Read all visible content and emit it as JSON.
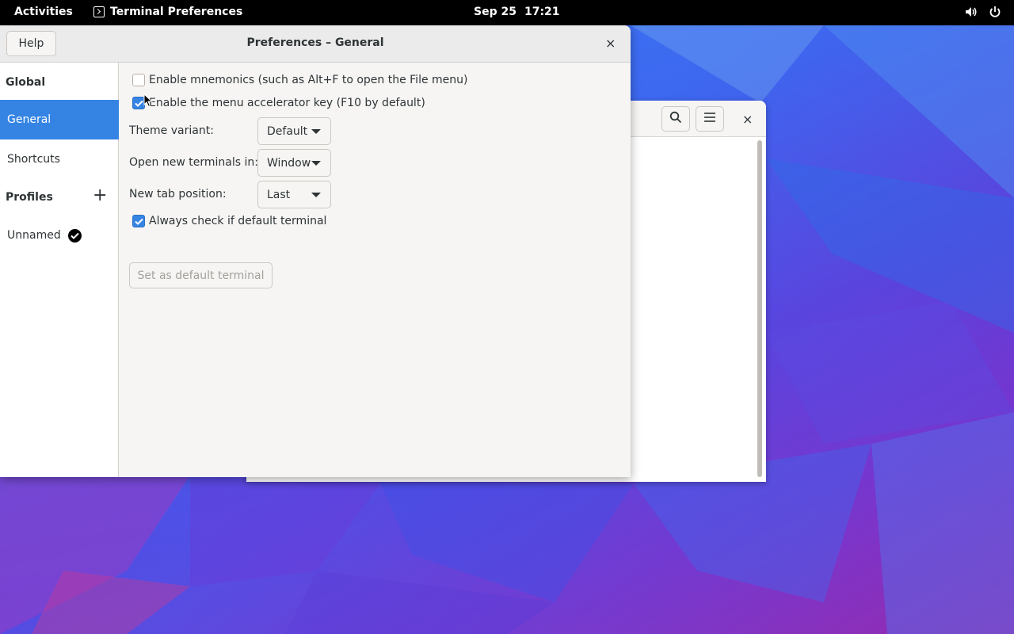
{
  "topbar": {
    "activities": "Activities",
    "app_name": "Terminal Preferences",
    "date": "Sep 25",
    "time": "17:21",
    "icons": [
      "volume-icon",
      "power-icon"
    ]
  },
  "prefs_window": {
    "help_label": "Help",
    "title": "Preferences – General",
    "close_glyph": "×"
  },
  "sidebar": {
    "global_heading": "Global",
    "items": [
      {
        "label": "General",
        "selected": true
      },
      {
        "label": "Shortcuts",
        "selected": false
      }
    ],
    "profiles_heading": "Profiles",
    "add_glyph": "+",
    "profiles": [
      {
        "label": "Unnamed",
        "default": true
      }
    ]
  },
  "general": {
    "enable_mnemonics": {
      "label": "Enable mnemonics (such as Alt+F to open the File menu)",
      "checked": false
    },
    "enable_accel": {
      "label": "Enable the menu accelerator key (F10 by default)",
      "checked": true
    },
    "theme_variant": {
      "label": "Theme variant:",
      "value": "Default"
    },
    "open_new_terminals": {
      "label": "Open new terminals in:",
      "value": "Window"
    },
    "new_tab_position": {
      "label": "New tab position:",
      "value": "Last"
    },
    "always_check": {
      "label": "Always check if default terminal",
      "checked": true
    },
    "set_default_label": "Set as default terminal"
  },
  "bg_window": {
    "close_glyph": "×",
    "icons": [
      "search-icon",
      "hamburger-menu-icon"
    ]
  },
  "colors": {
    "accent": "#3584e4",
    "window_bg": "#f6f5f4",
    "topbar": "#000000"
  }
}
